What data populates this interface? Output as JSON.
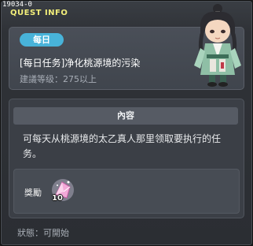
{
  "quest_id": "19034-0",
  "window_title": "QUEST INFO",
  "badge": "每日",
  "quest_name": "[每日任务]净化桃源境的污染",
  "recommended_level": "建議等级：275以上",
  "content_header": "內容",
  "description": "可每天从桃源境的太乙真人那里领取要执行的任务。",
  "reward": {
    "label": "獎勵",
    "count": "10",
    "icon": "pink-crystal-icon"
  },
  "status": "狀態：可開始",
  "colors": {
    "title": "#f3ef7a",
    "badge": "#48b3d9",
    "panel": "#3b3f46"
  }
}
